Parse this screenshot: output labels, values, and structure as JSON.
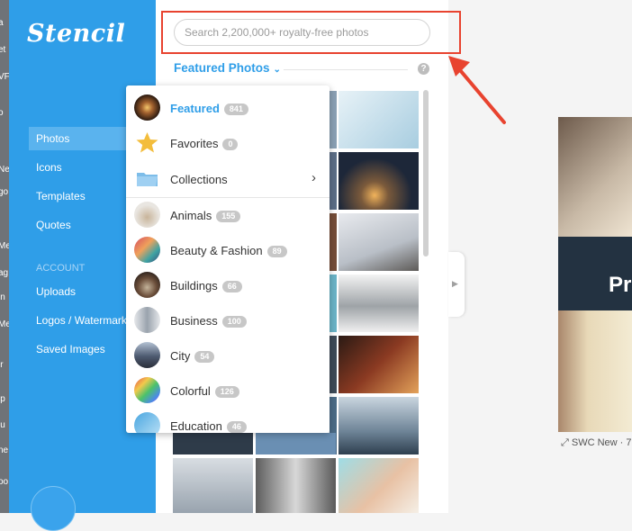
{
  "sidebar": {
    "logo": "Stencil",
    "nav": [
      {
        "label": "Photos",
        "active": true
      },
      {
        "label": "Icons"
      },
      {
        "label": "Templates"
      },
      {
        "label": "Quotes"
      }
    ],
    "account_heading": "ACCOUNT",
    "account_nav": [
      {
        "label": "Uploads"
      },
      {
        "label": "Logos / Watermarks"
      },
      {
        "label": "Saved Images"
      }
    ]
  },
  "search": {
    "placeholder": "Search 2,200,000+ royalty-free photos"
  },
  "section": {
    "title": "Featured Photos",
    "help": "?"
  },
  "dropdown": {
    "items": [
      {
        "label": "Featured",
        "count": "841",
        "active": true,
        "icon": "featured-thumb"
      },
      {
        "label": "Favorites",
        "count": "0",
        "icon": "star-icon"
      },
      {
        "label": "Collections",
        "icon": "folder-icon"
      },
      {
        "label": "Animals",
        "count": "155"
      },
      {
        "label": "Beauty & Fashion",
        "count": "89"
      },
      {
        "label": "Buildings",
        "count": "66"
      },
      {
        "label": "Business",
        "count": "100"
      },
      {
        "label": "City",
        "count": "54"
      },
      {
        "label": "Colorful",
        "count": "126"
      },
      {
        "label": "Education",
        "count": "46"
      }
    ]
  },
  "canvas": {
    "text": "Pr",
    "caption": "SWC New · 7"
  },
  "colors": {
    "brand": "#2f9ee8",
    "highlight": "#e8432f"
  }
}
